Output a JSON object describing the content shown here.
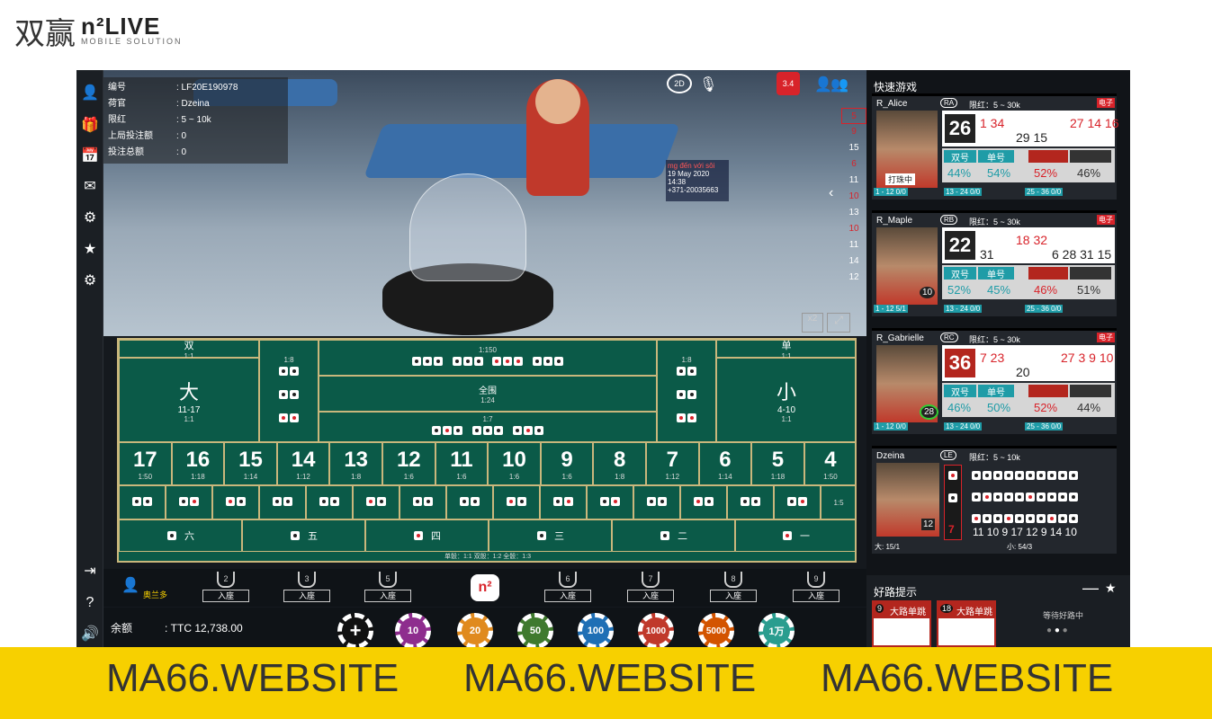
{
  "logo": {
    "cn": "双赢",
    "brand": "n²LIVE",
    "sub": "MOBILE SOLUTION"
  },
  "info": {
    "rows": [
      {
        "k": "编号",
        "v": ": LF20E190978"
      },
      {
        "k": "荷官",
        "v": ": Dzeina"
      },
      {
        "k": "限红",
        "v": ": 5 ~ 10k"
      },
      {
        "k": "上局投注额",
        "v": ": 0"
      },
      {
        "k": "投注总额",
        "v": ": 0"
      }
    ]
  },
  "video": {
    "badge": "3.4",
    "mode": "2D",
    "promo": "mg đến với sôi",
    "date": "19 May 2020",
    "time": "14:38",
    "phone": "+371-20035663"
  },
  "road": [
    "5",
    "9",
    "15",
    "6",
    "11",
    "10",
    "13",
    "10",
    "11",
    "14",
    "12"
  ],
  "board": {
    "double": "双",
    "single": "单",
    "odds11": "1:1",
    "big": "大",
    "bigrange": "11-17",
    "small": "小",
    "smallrange": "4-10",
    "triple_all": "全围",
    "odds124": "1:24",
    "odds1150": "1:150",
    "odds18": "1:8",
    "odds17": "1:7",
    "totals": [
      {
        "n": "17",
        "o": "1:50"
      },
      {
        "n": "16",
        "o": "1:18"
      },
      {
        "n": "15",
        "o": "1:14"
      },
      {
        "n": "14",
        "o": "1:12"
      },
      {
        "n": "13",
        "o": "1:8"
      },
      {
        "n": "12",
        "o": "1:6"
      },
      {
        "n": "11",
        "o": "1:6"
      },
      {
        "n": "10",
        "o": "1:6"
      },
      {
        "n": "9",
        "o": "1:6"
      },
      {
        "n": "8",
        "o": "1:8"
      },
      {
        "n": "7",
        "o": "1:12"
      },
      {
        "n": "6",
        "o": "1:14"
      },
      {
        "n": "5",
        "o": "1:18"
      },
      {
        "n": "4",
        "o": "1:50"
      }
    ],
    "pairodds": "1:5",
    "singles": [
      "六",
      "五",
      "四",
      "三",
      "二",
      "一"
    ],
    "footer": "单骰：1:1    双骰：1:2    全骰：1:3"
  },
  "seats": {
    "player": "奥兰多",
    "label": "入座",
    "numbers": [
      "2",
      "3",
      "5",
      "6",
      "7",
      "8",
      "9"
    ]
  },
  "chips": [
    "10",
    "20",
    "50",
    "100",
    "1000",
    "5000",
    "1万"
  ],
  "balance": {
    "label": "余额",
    "value": ": TTC 12,738.00"
  },
  "right": {
    "title": "快速游戏",
    "cards": [
      {
        "name": "R_Alice",
        "tag": "RA",
        "limit": "限红：5 ~ 30k",
        "e": "电子",
        "res": "26",
        "red": false,
        "h1": "1 34",
        "h2": "29 15",
        "h3": "27 14 16",
        "status": "打珠中",
        "labels": [
          "双号",
          "单号"
        ],
        "pct": [
          "44%",
          "54%",
          "52%",
          "46%"
        ],
        "f1": "1 - 12 0/0",
        "f2": "13 - 24 0/0",
        "f3": "25 - 36 0/0"
      },
      {
        "name": "R_Maple",
        "tag": "RB",
        "limit": "限红：5 ~ 30k",
        "e": "电子",
        "res": "22",
        "red": false,
        "h1": "31",
        "h2": "18 32",
        "h3": "6 28 31 15",
        "status": "10",
        "labels": [
          "双号",
          "单号"
        ],
        "pct": [
          "52%",
          "45%",
          "46%",
          "51%"
        ],
        "f1": "1 - 12 5/1",
        "f2": "13 - 24 0/0",
        "f3": "25 - 36 0/0"
      },
      {
        "name": "R_Gabrielle",
        "tag": "RC",
        "limit": "限红：5 ~ 30k",
        "e": "电子",
        "res": "36",
        "red": true,
        "h1": "7 23",
        "h2": "20",
        "h3": "27 3 9 10",
        "status": "28",
        "labels": [
          "双号",
          "单号"
        ],
        "pct": [
          "46%",
          "50%",
          "52%",
          "44%"
        ],
        "f1": "1 - 12 0/0",
        "f2": "13 - 24 0/0",
        "f3": "25 - 36 0/0"
      }
    ],
    "dz": {
      "name": "Dzeina",
      "tag": "LE",
      "limit": "限红：5 ~ 10k",
      "seat": "12",
      "last": "7",
      "hist": "11 10 9 17 12 9 14 10",
      "big": "大: 15/1",
      "small": "小: 54/3"
    },
    "hint": {
      "title": "好路提示",
      "a": "大路单跳",
      "an": "9",
      "b": "大路单跳",
      "bn": "18",
      "wait": "等待好路中"
    }
  },
  "banner": [
    "MA66.WEBSITE",
    "MA66.WEBSITE",
    "MA66.WEBSITE"
  ]
}
